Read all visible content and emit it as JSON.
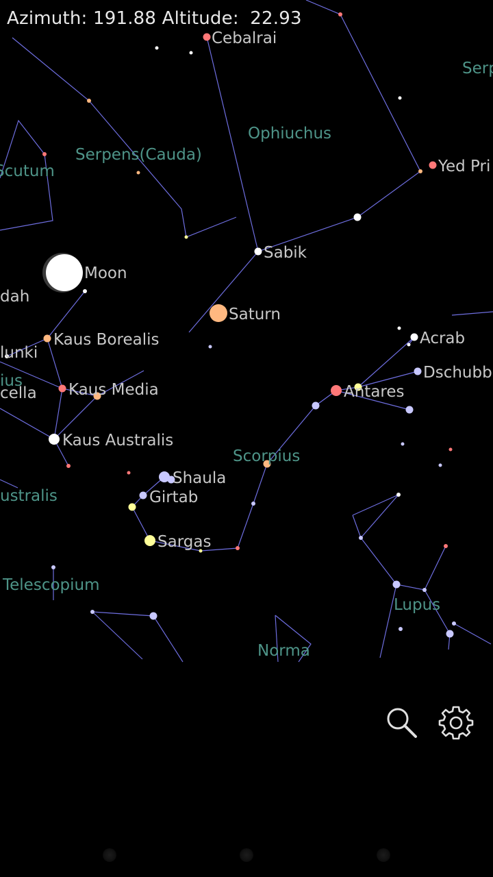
{
  "readout": {
    "azimuth_label": "Azimuth:",
    "azimuth_value": "191.88",
    "altitude_label": "Altitude:",
    "altitude_value": "22.93"
  },
  "colors": {
    "background": "#000000",
    "constellation_line": "#6e6ee0",
    "constellation_label": "#4e9488",
    "star_label": "#c8c8c8",
    "moon": "#ffffff",
    "planet_saturn": "#ffb880"
  },
  "constellations": {
    "ophiuchus": "Ophiuchus",
    "serpens_cauda": "Serpens(Cauda)",
    "serpens_caput": "Serp",
    "scutum": "Scutum",
    "scorpius": "Scorpius",
    "telescopium": "Telescopium",
    "lupus": "Lupus",
    "norma": "Norma",
    "corona_australis": "ustralis",
    "sagittarius": "ius"
  },
  "stars": {
    "cebalrai": "Cebalrai",
    "yed_prior": "Yed Pri",
    "sabik": "Sabik",
    "kaus_borealis": "Kaus Borealis",
    "kaus_media": "Kaus Media",
    "kaus_australis": "Kaus Australis",
    "acrab": "Acrab",
    "dschubba": "Dschubb",
    "antares": "Antares",
    "shaula": "Shaula",
    "girtab": "Girtab",
    "sargas": "Sargas",
    "albaldah": "dah",
    "nunki": "lunki",
    "ascella": "cella"
  },
  "bodies": {
    "moon": "Moon",
    "saturn": "Saturn"
  },
  "toolbar": {
    "search_icon": "search-icon",
    "settings_icon": "gear-icon"
  }
}
